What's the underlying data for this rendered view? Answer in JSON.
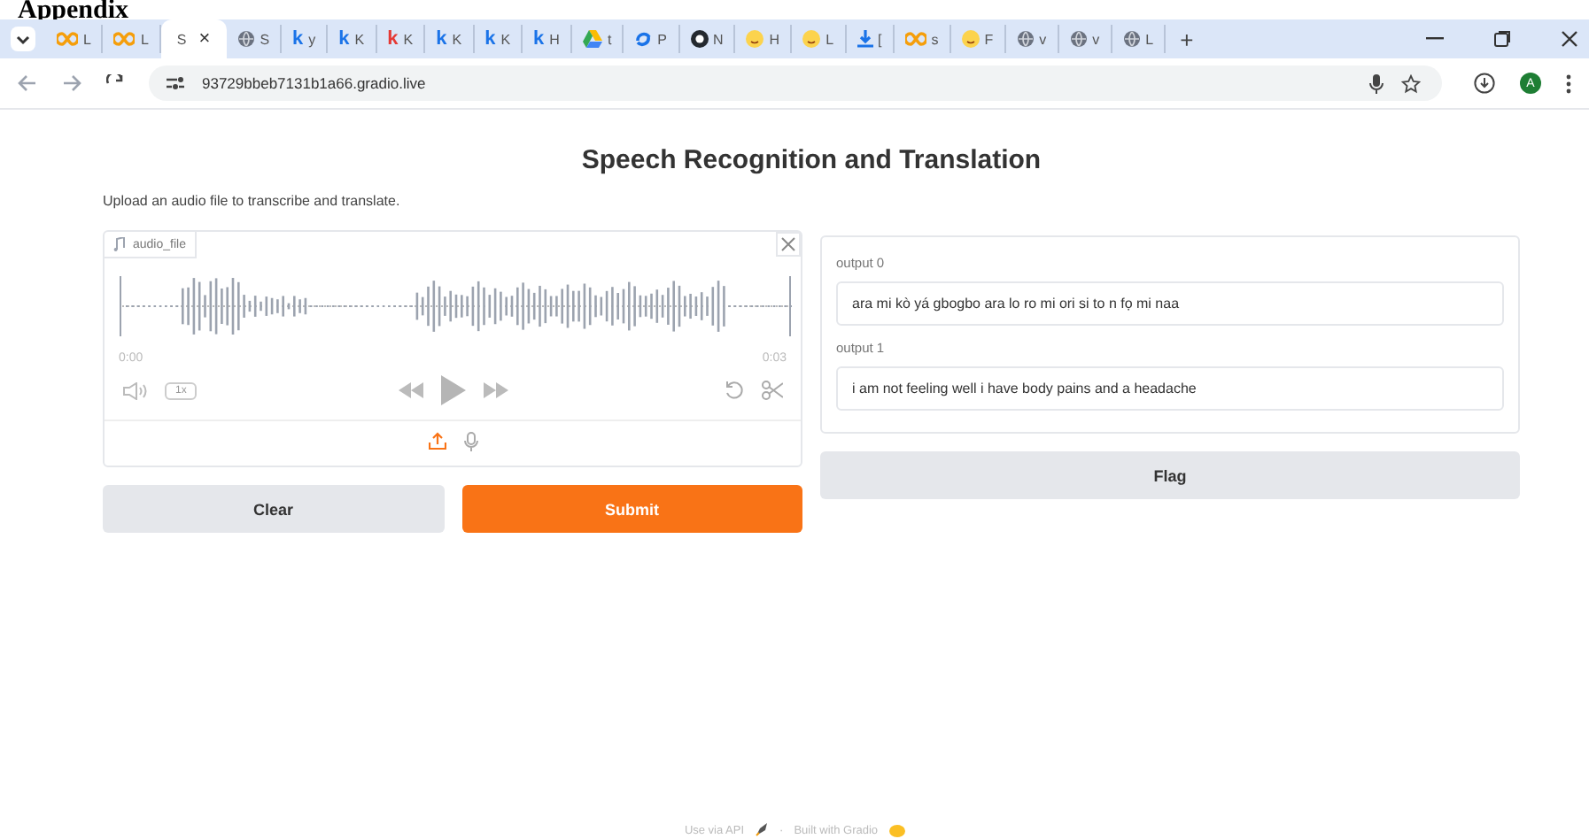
{
  "document_heading": "Appendix",
  "browser": {
    "tabs": [
      {
        "kind": "infinity",
        "label": "L",
        "selected": false
      },
      {
        "kind": "infinity",
        "label": "L",
        "selected": false
      },
      {
        "kind": "plain",
        "label": "S",
        "selected": true,
        "close": "×"
      },
      {
        "kind": "globe",
        "label": "S",
        "selected": false
      },
      {
        "kind": "letter",
        "icon_text": "k",
        "color": "#1a73e8",
        "label": "y",
        "selected": false
      },
      {
        "kind": "letter",
        "icon_text": "k",
        "color": "#1a73e8",
        "label": "K",
        "selected": false
      },
      {
        "kind": "letter",
        "icon_text": "k",
        "color": "#e53935",
        "label": "K",
        "selected": false
      },
      {
        "kind": "letter",
        "icon_text": "k",
        "color": "#1a73e8",
        "label": "K",
        "selected": false
      },
      {
        "kind": "letter",
        "icon_text": "k",
        "color": "#1a73e8",
        "label": "K",
        "selected": false
      },
      {
        "kind": "letter",
        "icon_text": "k",
        "color": "#1a73e8",
        "label": "H",
        "selected": false
      },
      {
        "kind": "drive",
        "label": "t",
        "selected": false
      },
      {
        "kind": "sync",
        "label": "P",
        "selected": false
      },
      {
        "kind": "github",
        "label": "N",
        "selected": false
      },
      {
        "kind": "face",
        "label": "H",
        "selected": false
      },
      {
        "kind": "face",
        "label": "L",
        "selected": false
      },
      {
        "kind": "download",
        "label": "[",
        "selected": false
      },
      {
        "kind": "infinity",
        "label": "s",
        "selected": false
      },
      {
        "kind": "face",
        "label": "F",
        "selected": false
      },
      {
        "kind": "globe",
        "label": "v",
        "selected": false
      },
      {
        "kind": "globe",
        "label": "v",
        "selected": false
      },
      {
        "kind": "globe",
        "label": "L",
        "selected": false
      }
    ],
    "new_tab": "+",
    "url": "93729bbeb7131b1a66.gradio.live",
    "profile_initial": "A"
  },
  "app": {
    "title": "Speech Recognition and Translation",
    "description": "Upload an audio file to transcribe and translate.",
    "audio": {
      "label": "audio_file",
      "start_time": "0:00",
      "end_time": "0:03",
      "speed": "1x"
    },
    "outputs": [
      {
        "label": "output 0",
        "value": "ara mi kò yá gbogbo ara lo ro mi ori si to n fọ mi naa"
      },
      {
        "label": "output 1",
        "value": "i am not feeling well i have body pains and a headache"
      }
    ],
    "buttons": {
      "clear": "Clear",
      "submit": "Submit",
      "flag": "Flag"
    }
  },
  "footer": {
    "api_link": "Use via API",
    "separator": "·",
    "built_with": "Built with Gradio"
  }
}
